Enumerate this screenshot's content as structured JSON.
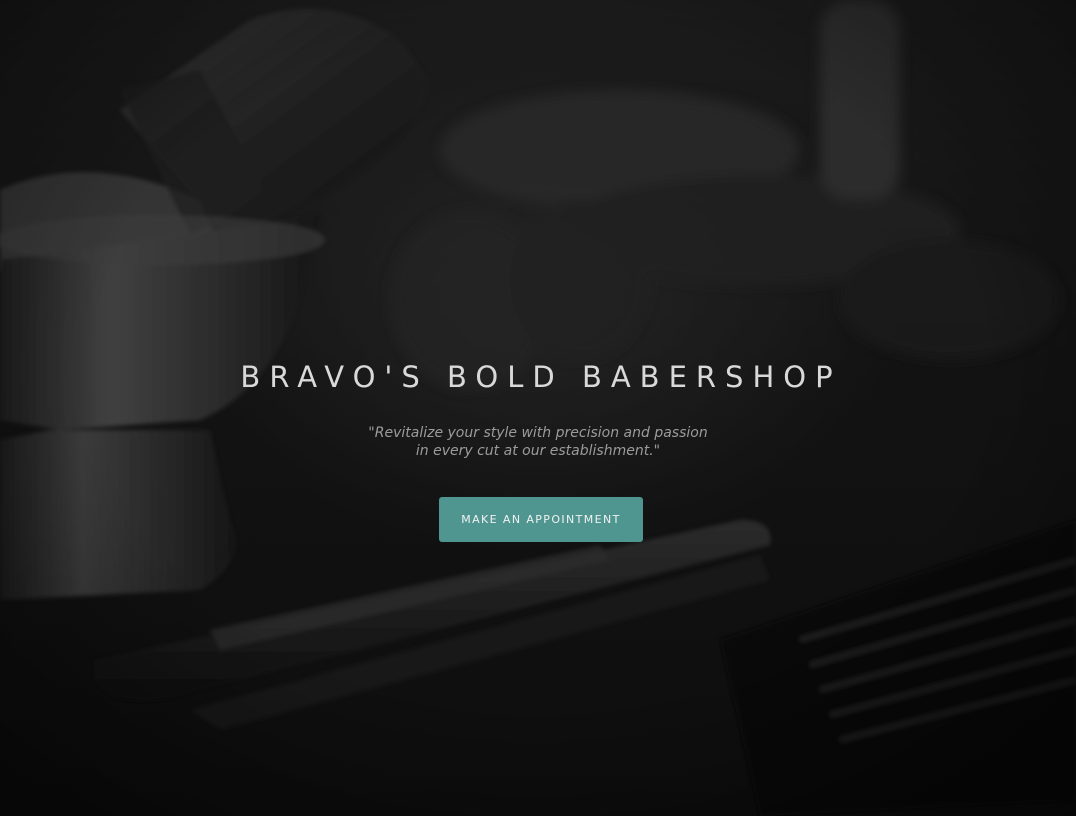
{
  "hero": {
    "title": "BRAVO'S BOLD BABERSHOP",
    "tagline_line1": "\"Revitalize your style with precision and passion",
    "tagline_line2": "in every cut at our establishment.\"",
    "cta_label": "MAKE AN APPOINTMENT"
  },
  "colors": {
    "accent": "#4f9690",
    "title_text": "#d9d9d9",
    "tagline_text": "#9b9b9b",
    "background": "#141414"
  }
}
